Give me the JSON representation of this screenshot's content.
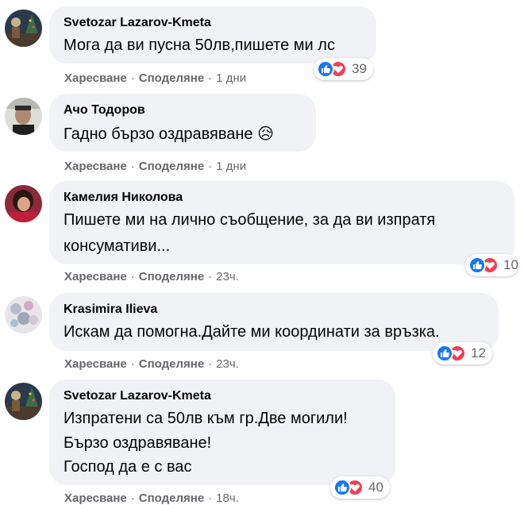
{
  "labels": {
    "like": "Харесване",
    "share": "Споделяне",
    "dot": "·"
  },
  "comments": [
    {
      "author": "Svetozar Lazarov-Kmeta",
      "lines": [
        "Мога да ви пусна 50лв,пишете ми лс"
      ],
      "time": "1 дни",
      "reaction_count": "39"
    },
    {
      "author": "Ачо Тодоров",
      "lines": [
        "Гадно бързо оздравяване 😥"
      ],
      "time": "1 дни",
      "reaction_count": ""
    },
    {
      "author": "Камелия Николова",
      "lines": [
        "Пишете ми на лично съобщение, за да ви изпратя",
        "консумативи..."
      ],
      "time": "23ч.",
      "reaction_count": "10"
    },
    {
      "author": "Krasimira Ilieva",
      "lines": [
        "Искам да помогна.Дайте ми координати за връзка."
      ],
      "time": "23ч.",
      "reaction_count": "12"
    },
    {
      "author": "Svetozar Lazarov-Kmeta",
      "lines": [
        "Изпратени са 50лв към гр.Две могили!",
        "Бързо оздравяване!",
        "Господ да е с вас"
      ],
      "time": "18ч.",
      "reaction_count": "40"
    }
  ],
  "colors": {
    "bubble": "#f0f2f5",
    "meta": "#65676b",
    "like": "#1877f2",
    "love": "#f33e58"
  }
}
